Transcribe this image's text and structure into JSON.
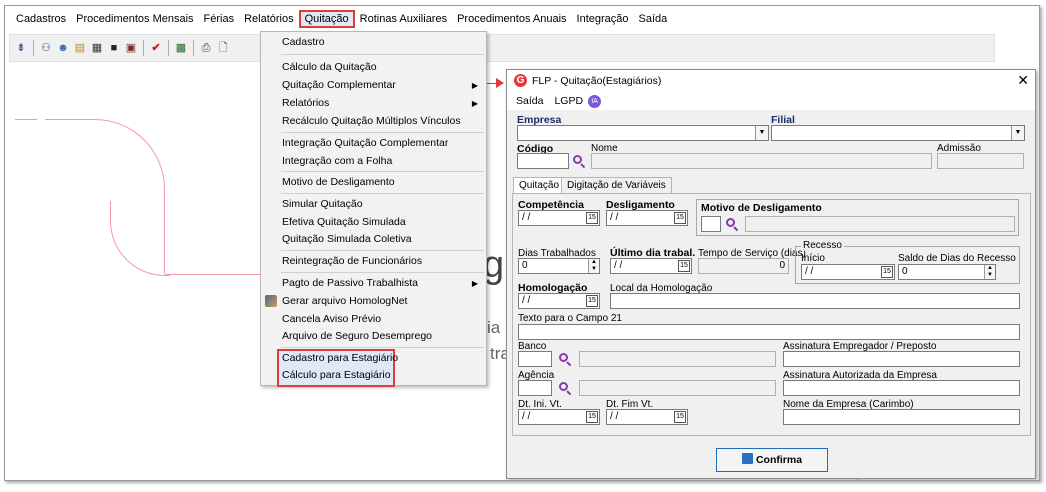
{
  "menubar": {
    "items": [
      "Cadastros",
      "Procedimentos Mensais",
      "Férias",
      "Relatórios",
      "Quitação",
      "Rotinas Auxiliares",
      "Procedimentos Anuais",
      "Integração",
      "Saída"
    ]
  },
  "background": {
    "big_text": "gl",
    "line1": "ia r",
    "line2": "tra"
  },
  "dropdown": {
    "items": {
      "cadastro": "Cadastro",
      "calculo": "Cálculo da Quitação",
      "complementar": "Quitação Complementar",
      "relatorios": "Relatórios",
      "recalculo": "Recálculo Quitação Múltiplos Vínculos",
      "integracao_compl": "Integração Quitação Complementar",
      "integracao_folha": "Integração com a Folha",
      "motivo": "Motivo de Desligamento",
      "simular": "Simular Quitação",
      "efetiva": "Efetiva Quitação Simulada",
      "coletiva": "Quitação Simulada Coletiva",
      "reintegracao": "Reintegração de Funcionários",
      "passivo": "Pagto de Passivo Trabalhista",
      "homolognet": "Gerar arquivo HomologNet",
      "cancela": "Cancela Aviso Prévio",
      "seguro": "Arquivo de Seguro Desemprego",
      "cad_estagiario": "Cadastro para Estagiário",
      "calc_estagiario": "Cálculo para Estagiário"
    }
  },
  "dialog": {
    "title": "FLP - Quitação(Estagiários)",
    "menu": {
      "saida": "Saída",
      "lgpd": "LGPD",
      "ia": "IA"
    },
    "labels": {
      "empresa": "Empresa",
      "filial": "Filial",
      "codigo": "Código",
      "nome": "Nome",
      "admissao": "Admissão",
      "competencia": "Competência",
      "desligamento": "Desligamento",
      "motivo": "Motivo de Desligamento",
      "dias_trab": "Dias Trabalhados",
      "ultimo_dia": "Último dia trabal.",
      "tempo_servico": "Tempo de Serviço (dias)",
      "recesso": "Recesso",
      "inicio": "Início",
      "saldo_recesso": "Saldo de Dias do Recesso",
      "homologacao": "Homologação",
      "local_homologacao": "Local da Homologação",
      "texto_campo21": "Texto para o Campo 21",
      "banco": "Banco",
      "assinatura_empregador": "Assinatura Empregador / Preposto",
      "agencia": "Agência",
      "assinatura_empresa": "Assinatura Autorizada da Empresa",
      "dt_ini_vt": "Dt. Ini. Vt.",
      "dt_fim_vt": "Dt. Fim Vt.",
      "nome_empresa": "Nome da Empresa (Carimbo)"
    },
    "tabs": [
      "Quitação",
      "Digitação de Variáveis"
    ],
    "values": {
      "date_empty": " / /",
      "dias_trab": "0",
      "tempo_servico": "0",
      "saldo": "0"
    },
    "confirm_label": "Confirma"
  }
}
